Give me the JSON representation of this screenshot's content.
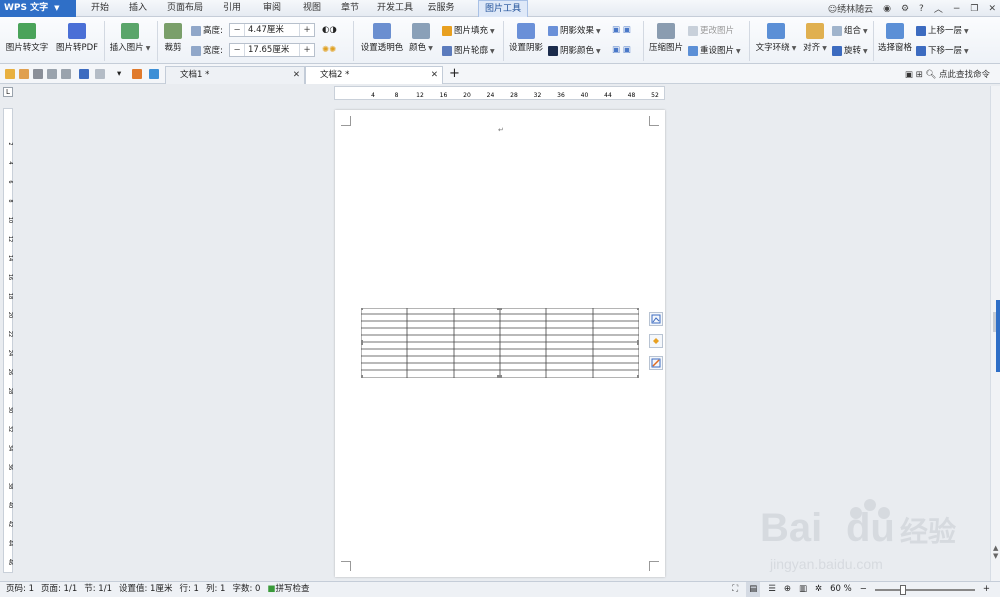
{
  "app": {
    "name": "WPS 文字"
  },
  "menu_tabs": [
    "开始",
    "插入",
    "页面布局",
    "引用",
    "审阅",
    "视图",
    "章节",
    "开发工具",
    "云服务",
    "图片工具"
  ],
  "active_tab": "图片工具",
  "window_controls": {
    "user": "绣林随云",
    "help": "?"
  },
  "ribbon": {
    "pic_to_text": "图片转文字",
    "pic_to_pdf": "图片转PDF",
    "insert_picture": "插入图片",
    "crop": "裁剪",
    "height_label": "高度:",
    "height_value": "4.47厘米",
    "width_label": "宽度:",
    "width_value": "17.65厘米",
    "set_transparent": "设置透明色",
    "color": "颜色",
    "pic_fill": "图片填充",
    "pic_outline": "图片轮廓",
    "set_shadow": "设置阴影",
    "shadow_effect": "阴影效果",
    "shadow_color": "阴影颜色",
    "compress": "压缩图片",
    "change_pic": "更改图片",
    "reset_pic": "重设图片",
    "text_wrap": "文字环绕",
    "align": "对齐",
    "group": "组合",
    "rotate": "旋转",
    "select_pane": "选择窗格",
    "bring_forward": "上移一层",
    "send_backward": "下移一层",
    "minus": "−",
    "plus": "+"
  },
  "doc_tabs": [
    {
      "label": "文档1 *",
      "active": false
    },
    {
      "label": "文档2 *",
      "active": true
    }
  ],
  "new_tab": "+",
  "search_cmd": "点此查找命令",
  "ruler": {
    "h_ticks": [
      "4",
      "8",
      "12",
      "16",
      "20",
      "24",
      "28",
      "32",
      "36",
      "40",
      "44",
      "48",
      "52"
    ],
    "v_ticks": [
      "2",
      "4",
      "6",
      "8",
      "10",
      "12",
      "14",
      "16",
      "18",
      "20",
      "22",
      "24",
      "26",
      "28",
      "30",
      "32",
      "34",
      "36",
      "38",
      "40",
      "42",
      "44",
      "46"
    ]
  },
  "status": {
    "page": "页码: 1",
    "pages": "页面: 1/1",
    "section": "节: 1/1",
    "setting": "设置值: 1厘米",
    "row": "行: 1",
    "col": "列: 1",
    "words": "字数: 0",
    "spell": "拼写检查",
    "zoom": "60 %",
    "zoom_minus": "−",
    "zoom_plus": "+"
  },
  "zoom_level": 0.28,
  "colors": {
    "accent": "#2f6fc7",
    "page": "#ffffff",
    "workspace": "#e9ecf0"
  },
  "watermark": {
    "text": "Bai du 经验",
    "url": "jingyan.baidu.com"
  }
}
